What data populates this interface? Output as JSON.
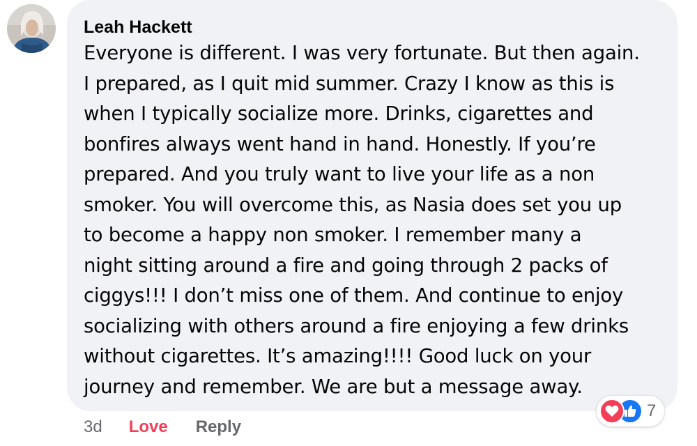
{
  "comment": {
    "author": "Leah Hackett",
    "body": "Everyone is different. I was very fortunate. But then again.\nI prepared, as I quit mid summer. Crazy I know as this is\nwhen I typically socialize more. Drinks, cigarettes and\nbonfires always went hand in hand. Honestly. If you’re\nprepared. And you truly want to live your life as a non\nsmoker. You will overcome this, as Nasia does set you up\nto become a happy non smoker. I remember many a\nnight sitting around a fire and going through 2 packs of\nciggys!!! I don’t miss one of them. And continue to enjoy\nsocializing with others around a fire enjoying a few drinks\nwithout cigarettes. It’s amazing!!!! Good luck on your\njourney and remember. We are but a message away."
  },
  "reactions": {
    "icons": [
      "heart-icon",
      "thumbs-up-icon"
    ],
    "count": "7"
  },
  "actions": {
    "timestamp": "3d",
    "love_label": "Love",
    "reply_label": "Reply"
  },
  "colors": {
    "bubble_bg": "#f0f2f5",
    "text": "#050505",
    "muted": "#65676b",
    "love": "#f33e58",
    "like": "#1877f2"
  }
}
